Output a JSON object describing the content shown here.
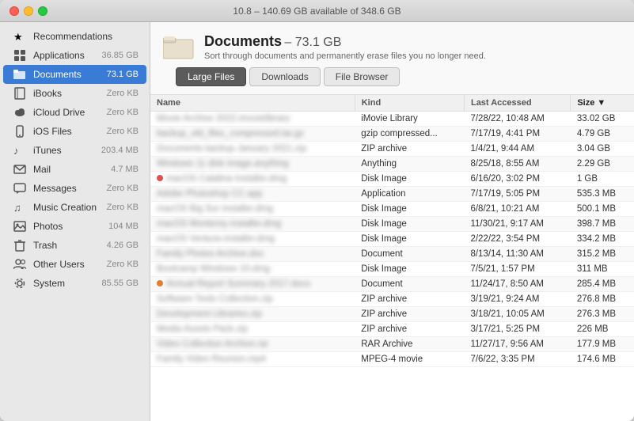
{
  "window": {
    "title": "10.8 – 140.69 GB available of 348.6 GB"
  },
  "traffic_lights": {
    "close_label": "close",
    "minimize_label": "minimize",
    "maximize_label": "maximize"
  },
  "sidebar": {
    "items": [
      {
        "id": "recommendations",
        "label": "Recommendations",
        "size": "",
        "icon": "star"
      },
      {
        "id": "applications",
        "label": "Applications",
        "size": "36.85 GB",
        "icon": "grid"
      },
      {
        "id": "documents",
        "label": "Documents",
        "size": "73.1 GB",
        "icon": "folder",
        "active": true
      },
      {
        "id": "ibooks",
        "label": "iBooks",
        "size": "Zero KB",
        "icon": "book"
      },
      {
        "id": "icloud-drive",
        "label": "iCloud Drive",
        "size": "Zero KB",
        "icon": "cloud"
      },
      {
        "id": "ios-files",
        "label": "iOS Files",
        "size": "Zero KB",
        "icon": "phone"
      },
      {
        "id": "itunes",
        "label": "iTunes",
        "size": "203.4 MB",
        "icon": "music"
      },
      {
        "id": "mail",
        "label": "Mail",
        "size": "4.7 MB",
        "icon": "envelope"
      },
      {
        "id": "messages",
        "label": "Messages",
        "size": "Zero KB",
        "icon": "chat"
      },
      {
        "id": "music-creation",
        "label": "Music Creation",
        "size": "Zero KB",
        "icon": "note"
      },
      {
        "id": "photos",
        "label": "Photos",
        "size": "104 MB",
        "icon": "image"
      },
      {
        "id": "trash",
        "label": "Trash",
        "size": "4.26 GB",
        "icon": "trash"
      },
      {
        "id": "other-users",
        "label": "Other Users",
        "size": "Zero KB",
        "icon": "people"
      },
      {
        "id": "system",
        "label": "System",
        "size": "85.55 GB",
        "icon": "gear"
      }
    ]
  },
  "content": {
    "folder_name": "Documents",
    "folder_size": "73.1 GB",
    "folder_subtitle": "Sort through documents and permanently erase files you no longer need.",
    "tabs": [
      {
        "id": "large-files",
        "label": "Large Files",
        "active": true
      },
      {
        "id": "downloads",
        "label": "Downloads",
        "active": false
      },
      {
        "id": "file-browser",
        "label": "File Browser",
        "active": false
      }
    ],
    "table": {
      "columns": [
        {
          "id": "name",
          "label": "Name"
        },
        {
          "id": "kind",
          "label": "Kind"
        },
        {
          "id": "last-accessed",
          "label": "Last Accessed"
        },
        {
          "id": "size",
          "label": "Size ▼"
        }
      ],
      "rows": [
        {
          "name": "BLURRED_1",
          "kind": "iMovie Library",
          "last_accessed": "7/28/22, 10:48 AM",
          "size": "33.02 GB",
          "blurred": true,
          "dot": ""
        },
        {
          "name": "BLURRED_2",
          "kind": "gzip compressed...",
          "last_accessed": "7/17/19, 4:41 PM",
          "size": "4.79 GB",
          "blurred": true,
          "dot": ""
        },
        {
          "name": "BLURRED_3",
          "kind": "ZIP archive",
          "last_accessed": "1/4/21, 9:44 AM",
          "size": "3.04 GB",
          "blurred": true,
          "dot": ""
        },
        {
          "name": "BLURRED_4",
          "kind": "Anything",
          "last_accessed": "8/25/18, 8:55 AM",
          "size": "2.29 GB",
          "blurred": true,
          "dot": ""
        },
        {
          "name": "BLURRED_5",
          "kind": "Disk Image",
          "last_accessed": "6/16/20, 3:02 PM",
          "size": "1 GB",
          "blurred": true,
          "dot": "red"
        },
        {
          "name": "BLURRED_6",
          "kind": "Application",
          "last_accessed": "7/17/19, 5:05 PM",
          "size": "535.3 MB",
          "blurred": true,
          "dot": ""
        },
        {
          "name": "BLURRED_7",
          "kind": "Disk Image",
          "last_accessed": "6/8/21, 10:21 AM",
          "size": "500.1 MB",
          "blurred": true,
          "dot": ""
        },
        {
          "name": "BLURRED_8",
          "kind": "Disk Image",
          "last_accessed": "11/30/21, 9:17 AM",
          "size": "398.7 MB",
          "blurred": true,
          "dot": ""
        },
        {
          "name": "BLURRED_9",
          "kind": "Disk Image",
          "last_accessed": "2/22/22, 3:54 PM",
          "size": "334.2 MB",
          "blurred": true,
          "dot": ""
        },
        {
          "name": "BLURRED_10",
          "kind": "Document",
          "last_accessed": "8/13/14, 11:30 AM",
          "size": "315.2 MB",
          "blurred": true,
          "dot": ""
        },
        {
          "name": "BLURRED_11",
          "kind": "Disk Image",
          "last_accessed": "7/5/21, 1:57 PM",
          "size": "311 MB",
          "blurred": true,
          "dot": ""
        },
        {
          "name": "BLURRED_12",
          "kind": "Document",
          "last_accessed": "11/24/17, 8:50 AM",
          "size": "285.4 MB",
          "blurred": true,
          "dot": "orange"
        },
        {
          "name": "BLURRED_13",
          "kind": "ZIP archive",
          "last_accessed": "3/19/21, 9:24 AM",
          "size": "276.8 MB",
          "blurred": true,
          "dot": ""
        },
        {
          "name": "BLURRED_14",
          "kind": "ZIP archive",
          "last_accessed": "3/18/21, 10:05 AM",
          "size": "276.3 MB",
          "blurred": true,
          "dot": ""
        },
        {
          "name": "BLURRED_15",
          "kind": "ZIP archive",
          "last_accessed": "3/17/21, 5:25 PM",
          "size": "226 MB",
          "blurred": true,
          "dot": ""
        },
        {
          "name": "BLURRED_16",
          "kind": "RAR Archive",
          "last_accessed": "11/27/17, 9:56 AM",
          "size": "177.9 MB",
          "blurred": true,
          "dot": ""
        },
        {
          "name": "BLURRED_17",
          "kind": "MPEG-4 movie",
          "last_accessed": "7/6/22, 3:35 PM",
          "size": "174.6 MB",
          "blurred": true,
          "dot": ""
        }
      ]
    }
  },
  "icons": {
    "star": "★",
    "grid": "⊞",
    "folder": "📁",
    "book": "📖",
    "cloud": "☁",
    "phone": "📱",
    "music": "♪",
    "envelope": "✉",
    "chat": "💬",
    "note": "♫",
    "image": "🖼",
    "trash": "🗑",
    "people": "👥",
    "gear": "⚙"
  }
}
